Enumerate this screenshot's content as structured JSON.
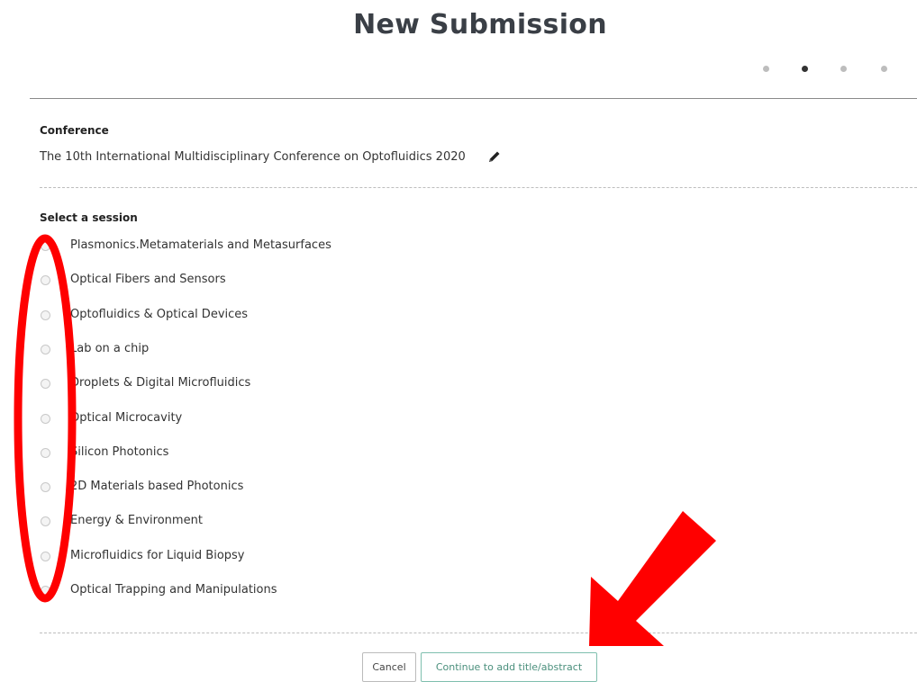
{
  "header": {
    "title": "New Submission",
    "steps": {
      "total": 4,
      "current": 2
    }
  },
  "conference": {
    "label": "Conference",
    "name": "The 10th International Multidisciplinary Conference on Optofluidics 2020",
    "edit_icon": "pencil-icon"
  },
  "session": {
    "label": "Select a session",
    "options": [
      "Plasmonics.Metamaterials and Metasurfaces",
      "Optical Fibers and Sensors",
      "Optofluidics & Optical Devices",
      "Lab on a chip",
      "Droplets & Digital Microfluidics",
      "Optical Microcavity",
      "Silicon Photonics",
      "2D Materials based Photonics",
      "Energy & Environment",
      "Microfluidics for Liquid Biopsy",
      "Optical Trapping and Manipulations"
    ]
  },
  "actions": {
    "cancel_label": "Cancel",
    "continue_label": "Continue to add title/abstract"
  },
  "annotation": {
    "highlight_color": "#ff0000",
    "arrow_icon": "arrow-down-left-icon",
    "ellipse": "radio-column-highlight"
  }
}
